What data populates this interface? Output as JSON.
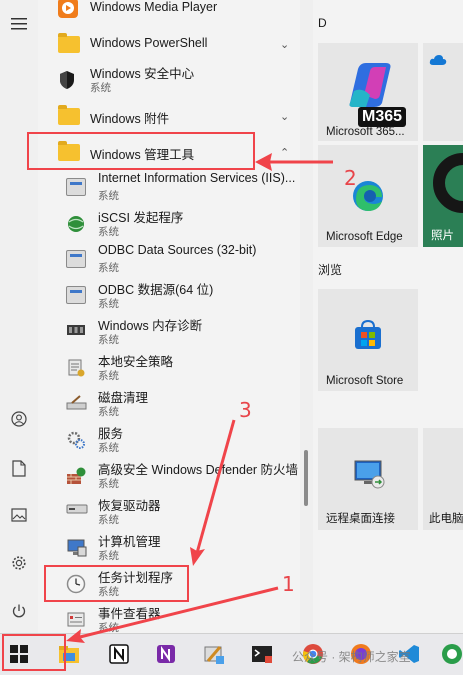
{
  "rail": {
    "menu_icon": "hamburger-menu-icon",
    "user_icon": "user-icon",
    "documents_icon": "documents-icon",
    "pictures_icon": "pictures-icon",
    "settings_icon": "gear-icon",
    "power_icon": "power-icon"
  },
  "apps": [
    {
      "title": "Windows Media Player",
      "sub": "",
      "icon": "media-player-icon"
    },
    {
      "title": "Windows PowerShell",
      "sub": "",
      "icon": "folder-icon",
      "chevron": "⌄"
    },
    {
      "title": "Windows 安全中心",
      "sub": "系统",
      "icon": "shield-icon"
    },
    {
      "title": "Windows 附件",
      "sub": "",
      "icon": "folder-icon",
      "chevron": "⌄"
    },
    {
      "title": "Windows 管理工具",
      "sub": "",
      "icon": "folder-icon",
      "chevron": "⌃"
    },
    {
      "title": "Internet Information Services (IIS)...",
      "sub": "系统"
    },
    {
      "title": "iSCSI 发起程序",
      "sub": "系统"
    },
    {
      "title": "ODBC Data Sources (32-bit)",
      "sub": "系统"
    },
    {
      "title": "ODBC 数据源(64 位)",
      "sub": "系统"
    },
    {
      "title": "Windows 内存诊断",
      "sub": "系统"
    },
    {
      "title": "本地安全策略",
      "sub": "系统"
    },
    {
      "title": "磁盘清理",
      "sub": "系统"
    },
    {
      "title": "服务",
      "sub": "系统"
    },
    {
      "title": "高级安全 Windows Defender 防火墙",
      "sub": "系统"
    },
    {
      "title": "恢复驱动器",
      "sub": "系统"
    },
    {
      "title": "计算机管理",
      "sub": "系统"
    },
    {
      "title": "任务计划程序",
      "sub": "系统"
    },
    {
      "title": "事件查看器",
      "sub": "系统"
    }
  ],
  "tiles": {
    "group_d": "D",
    "group_browse": "浏览",
    "m365_label": "Microsoft 365...",
    "m365_badge": "M365",
    "edge_label": "Microsoft Edge",
    "photos_label": "照片",
    "store_label": "Microsoft Store",
    "rdp_label": "远程桌面连接",
    "pc_label": "此电脑"
  },
  "annotations": {
    "n1": "1",
    "n2": "2",
    "n3": "3",
    "color": "#f0444a"
  },
  "watermark": "公众号 · 架构师之家室",
  "taskbar": {
    "items": [
      "start-button",
      "file-explorer-icon",
      "notion-icon",
      "onenote-icon",
      "tools-icon",
      "terminal-icon",
      "chrome-icon",
      "firefox-icon",
      "vscode-icon",
      "browser-icon"
    ]
  }
}
